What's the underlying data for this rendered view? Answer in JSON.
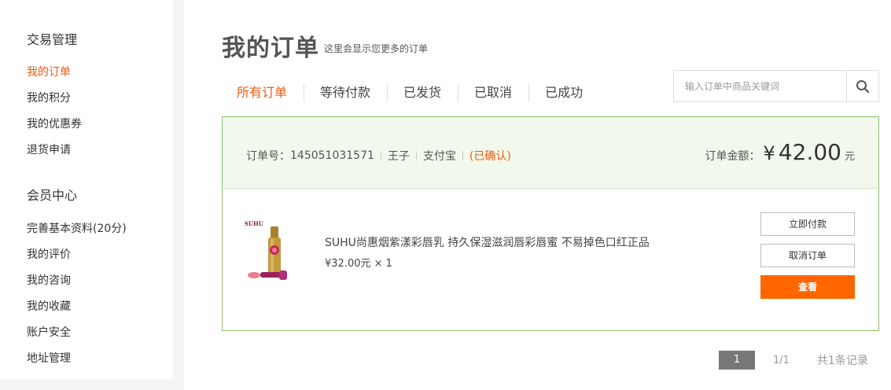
{
  "sidebar": {
    "groups": [
      {
        "title": "交易管理",
        "items": [
          {
            "label": "我的订单",
            "active": true
          },
          {
            "label": "我的积分"
          },
          {
            "label": "我的优惠券"
          },
          {
            "label": "退货申请"
          }
        ]
      },
      {
        "title": "会员中心",
        "items": [
          {
            "label": "完善基本资料(20分)"
          },
          {
            "label": "我的评价"
          },
          {
            "label": "我的咨询"
          },
          {
            "label": "我的收藏"
          },
          {
            "label": "账户安全"
          },
          {
            "label": "地址管理"
          }
        ]
      }
    ]
  },
  "header": {
    "title": "我的订单",
    "subtitle": "这里会显示您更多的订单"
  },
  "tabs": [
    {
      "label": "所有订单",
      "active": true
    },
    {
      "label": "等待付款"
    },
    {
      "label": "已发货"
    },
    {
      "label": "已取消"
    },
    {
      "label": "已成功"
    }
  ],
  "search": {
    "placeholder": "输入订单中商品关键词",
    "value": ""
  },
  "order": {
    "number_label": "订单号：",
    "number": "145051031571",
    "buyer": "王子",
    "payment": "支付宝",
    "status": "(已确认)",
    "amount_label": "订单金额：",
    "currency_symbol": "¥",
    "amount": "42.00",
    "amount_unit": "元",
    "product": {
      "brand_logo": "SUHU",
      "name": "SUHU尚惠烟紫漾彩唇乳 持久保湿滋润唇彩唇蜜 不易掉色口红正品",
      "price": "¥32.00元 × 1"
    },
    "buttons": {
      "pay": "立即付款",
      "cancel": "取消订单",
      "view": "查看"
    }
  },
  "pagination": {
    "current": "1",
    "info": "1/1",
    "total": "共1条记录"
  },
  "colors": {
    "accent": "#ee5a11",
    "button_primary": "#ff6600",
    "order_border": "#8fc06c",
    "order_head_bg": "#f2f8ec"
  },
  "icons": {
    "search": "search-icon"
  }
}
